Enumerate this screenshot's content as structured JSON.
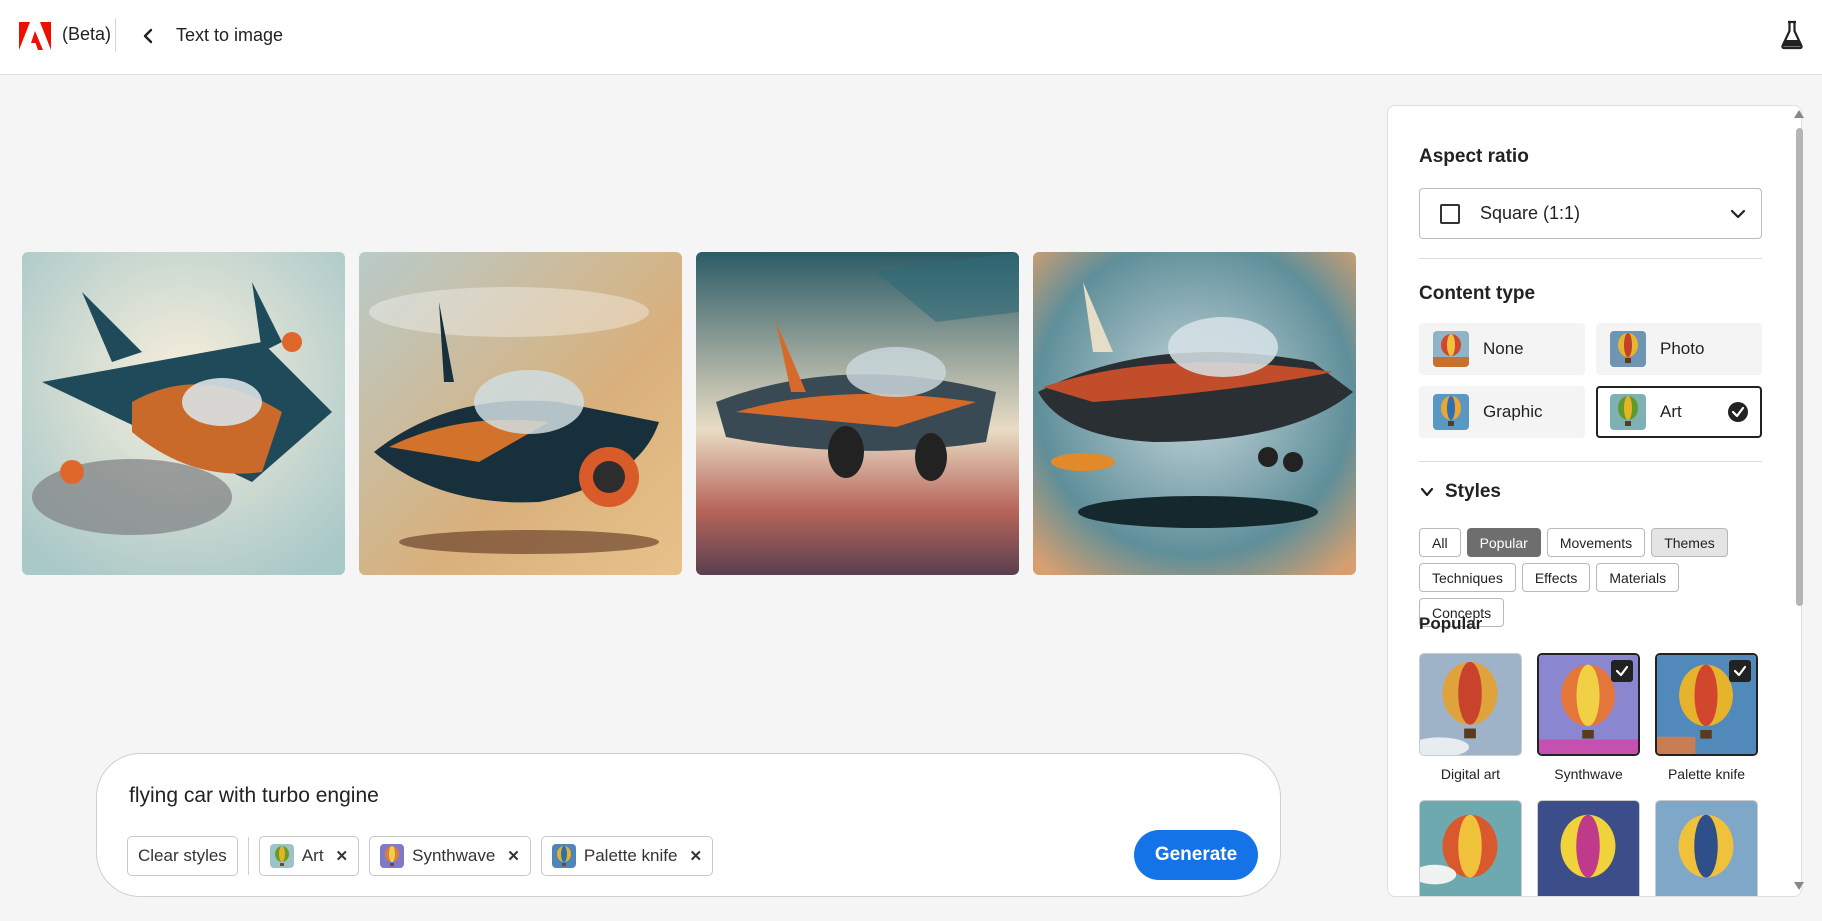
{
  "header": {
    "beta_label": "(Beta)",
    "title": "Text to image",
    "brand_color": "#eb1000"
  },
  "gallery": {
    "images": [
      {
        "icon": "flying-car-art-1"
      },
      {
        "icon": "flying-car-art-2"
      },
      {
        "icon": "flying-car-art-3"
      },
      {
        "icon": "flying-car-art-4"
      }
    ]
  },
  "prompt": {
    "text": "flying car with turbo engine",
    "clear_label": "Clear styles",
    "chips": [
      {
        "label": "Art"
      },
      {
        "label": "Synthwave"
      },
      {
        "label": "Palette knife"
      }
    ],
    "generate_label": "Generate",
    "accent_color": "#1473e6"
  },
  "panel": {
    "aspect_title": "Aspect ratio",
    "aspect_value": "Square (1:1)",
    "content_type_title": "Content type",
    "content_types": [
      {
        "label": "None",
        "selected": false
      },
      {
        "label": "Photo",
        "selected": false
      },
      {
        "label": "Graphic",
        "selected": false
      },
      {
        "label": "Art",
        "selected": true
      }
    ],
    "styles_title": "Styles",
    "filters": [
      {
        "label": "All"
      },
      {
        "label": "Popular"
      },
      {
        "label": "Movements"
      },
      {
        "label": "Themes"
      },
      {
        "label": "Techniques"
      },
      {
        "label": "Effects"
      },
      {
        "label": "Materials"
      },
      {
        "label": "Concepts"
      }
    ],
    "active_filter": "Popular",
    "popular_title": "Popular",
    "popular": [
      {
        "label": "Digital art",
        "selected": false
      },
      {
        "label": "Synthwave",
        "selected": true
      },
      {
        "label": "Palette knife",
        "selected": true
      },
      {
        "label": "",
        "selected": false
      },
      {
        "label": "",
        "selected": false
      },
      {
        "label": "",
        "selected": false
      }
    ]
  }
}
